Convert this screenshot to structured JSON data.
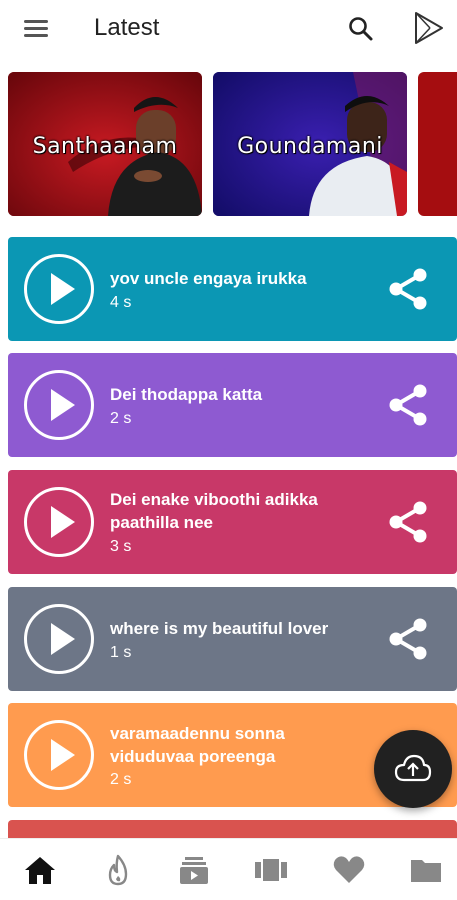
{
  "app_bar": {
    "title": "Latest",
    "icons": [
      "menu-icon",
      "search-icon",
      "play-store-icon"
    ]
  },
  "categories": [
    {
      "label": "Santhaanam",
      "color": "#8f0d14"
    },
    {
      "label": "Goundamani",
      "color": "#1f1a8a"
    },
    {
      "label": "",
      "color": "#a50d10"
    }
  ],
  "sounds": [
    {
      "title": "yov uncle engaya irukka",
      "duration": "4 s",
      "color": "#0b97b4"
    },
    {
      "title": "Dei thodappa katta",
      "duration": "2 s",
      "color": "#8e5ad1"
    },
    {
      "title": "Dei enake viboothi adikka paathilla nee",
      "duration": "3 s",
      "color": "#c83868"
    },
    {
      "title": "where is my beautiful lover",
      "duration": "1 s",
      "color": "#6d7687"
    },
    {
      "title": "varamaadennu sonna viduduvaa poreenga",
      "duration": "2 s",
      "color": "#ff9b4f"
    },
    {
      "title": "",
      "duration": "",
      "color": "#d9534f"
    }
  ],
  "fab": {
    "icon": "cloud-upload-icon"
  },
  "bottom_nav": [
    {
      "icon": "home-icon",
      "active": true
    },
    {
      "icon": "fire-icon",
      "active": false
    },
    {
      "icon": "playlist-icon",
      "active": false
    },
    {
      "icon": "carousel-icon",
      "active": false
    },
    {
      "icon": "heart-icon",
      "active": false
    },
    {
      "icon": "folder-icon",
      "active": false
    }
  ]
}
